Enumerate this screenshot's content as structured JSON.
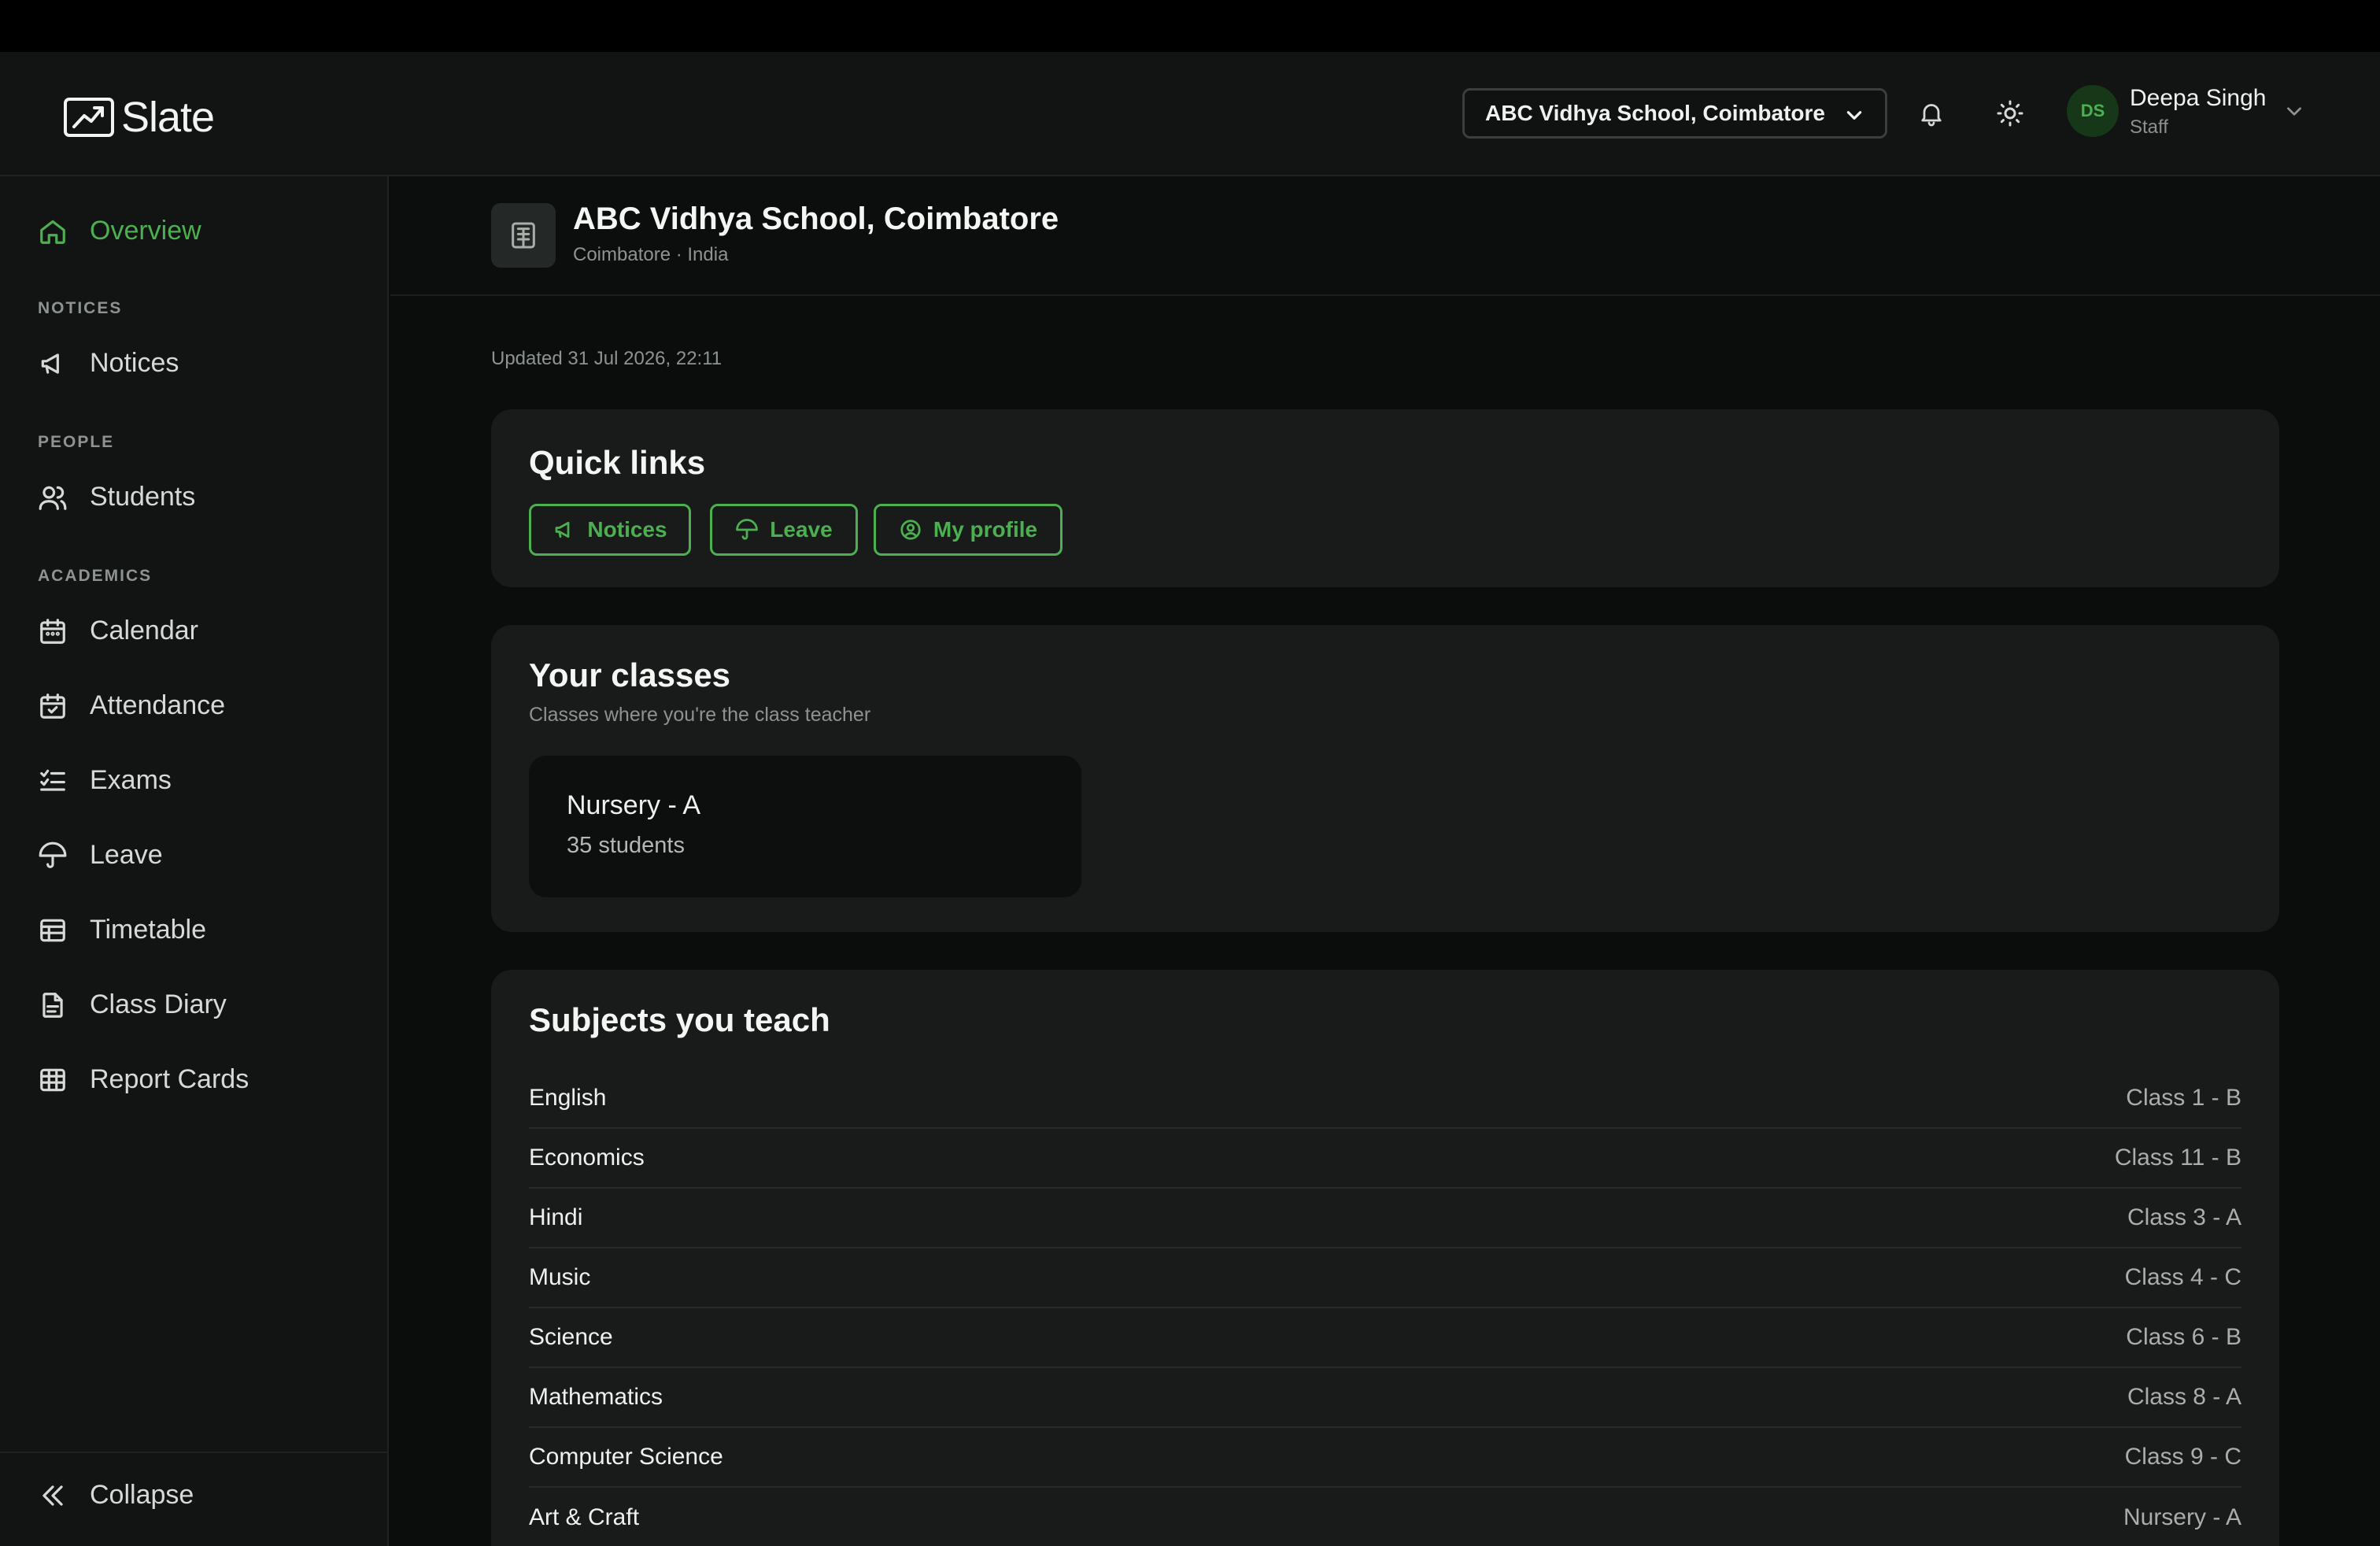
{
  "app": {
    "name": "Slate"
  },
  "header": {
    "school_selector": "ABC Vidhya School, Coimbatore",
    "user": {
      "initials": "DS",
      "name": "Deepa Singh",
      "role": "Staff"
    }
  },
  "sidebar": {
    "overview": "Overview",
    "sections": [
      {
        "title": "NOTICES",
        "items": [
          {
            "label": "Notices",
            "icon": "megaphone-icon"
          }
        ]
      },
      {
        "title": "PEOPLE",
        "items": [
          {
            "label": "Students",
            "icon": "users-icon"
          }
        ]
      },
      {
        "title": "ACADEMICS",
        "items": [
          {
            "label": "Calendar",
            "icon": "calendar-icon"
          },
          {
            "label": "Attendance",
            "icon": "calendar-check-icon"
          },
          {
            "label": "Exams",
            "icon": "checklist-icon"
          },
          {
            "label": "Leave",
            "icon": "umbrella-icon"
          },
          {
            "label": "Timetable",
            "icon": "table-icon"
          },
          {
            "label": "Class Diary",
            "icon": "document-icon"
          },
          {
            "label": "Report Cards",
            "icon": "grid-icon"
          }
        ]
      }
    ],
    "collapse": "Collapse"
  },
  "page": {
    "title": "ABC Vidhya School, Coimbatore",
    "subtitle": "Coimbatore · India",
    "updated": "Updated 31 Jul 2026, 22:11"
  },
  "quick_links": {
    "title": "Quick links",
    "buttons": [
      {
        "label": "Notices",
        "icon": "megaphone-icon"
      },
      {
        "label": "Leave",
        "icon": "umbrella-icon"
      },
      {
        "label": "My profile",
        "icon": "user-circle-icon"
      }
    ]
  },
  "classes": {
    "title": "Your classes",
    "subtitle": "Classes where you're the class teacher",
    "items": [
      {
        "name": "Nursery - A",
        "count": "35 students"
      }
    ]
  },
  "subjects": {
    "title": "Subjects you teach",
    "rows": [
      {
        "subject": "English",
        "class": "Class 1 - B"
      },
      {
        "subject": "Economics",
        "class": "Class 11 - B"
      },
      {
        "subject": "Hindi",
        "class": "Class 3 - A"
      },
      {
        "subject": "Music",
        "class": "Class 4 - C"
      },
      {
        "subject": "Science",
        "class": "Class 6 - B"
      },
      {
        "subject": "Mathematics",
        "class": "Class 8 - A"
      },
      {
        "subject": "Computer Science",
        "class": "Class 9 - C"
      },
      {
        "subject": "Art & Craft",
        "class": "Nursery - A"
      }
    ]
  },
  "colors": {
    "accent": "#4caf50",
    "background": "#0b0d0c",
    "panel": "#181b19"
  }
}
